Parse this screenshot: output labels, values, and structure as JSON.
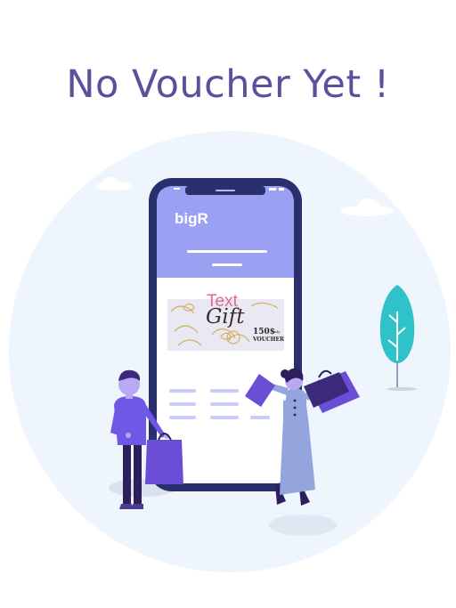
{
  "empty_state": {
    "title": "No Voucher Yet !"
  },
  "phone": {
    "brand": "bigR"
  },
  "gift_card": {
    "overlay_text": "Text",
    "headline": "Gift",
    "price": "150$",
    "price_suffix": "only",
    "label": "VOUCHER"
  },
  "colors": {
    "title": "#5e4f9c",
    "accent_purple": "#6a4fd6",
    "background_circle": "#eef5fc",
    "tree": "#2fc2c8",
    "phone_frame": "#2a2f6e",
    "phone_header": "#9aa1f2"
  }
}
